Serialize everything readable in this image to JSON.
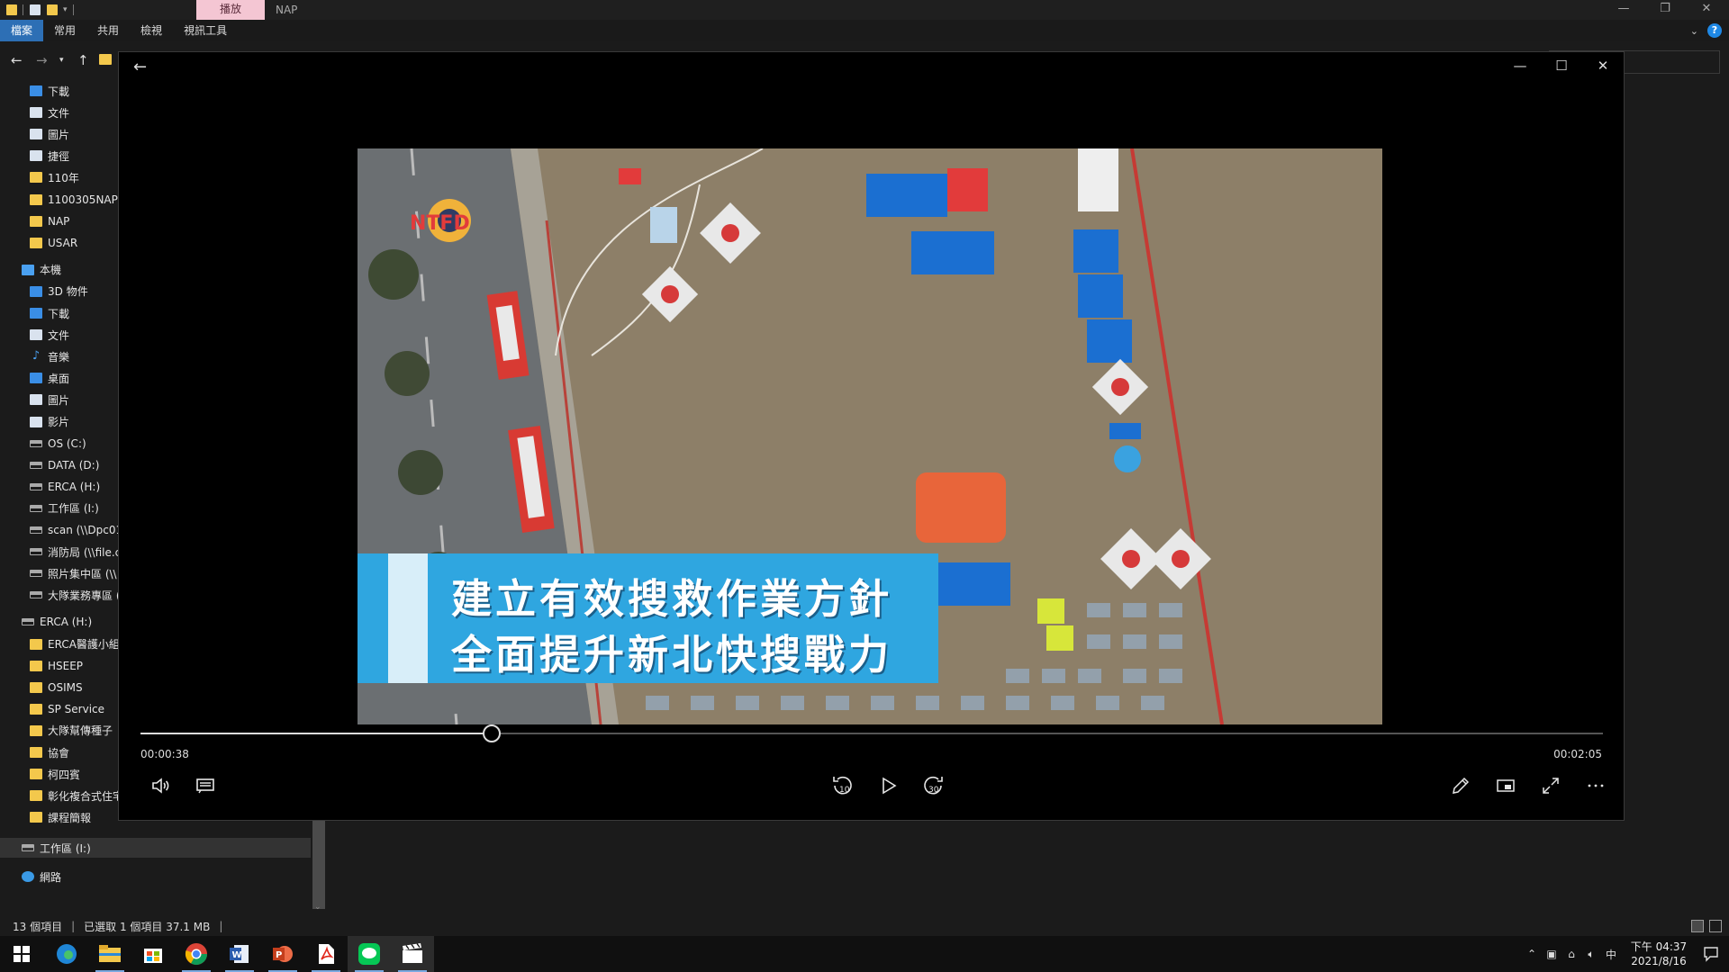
{
  "explorer": {
    "title": "NAP",
    "context_tab": "播放",
    "ribbon_tabs": [
      "檔案",
      "常用",
      "共用",
      "檢視",
      "視訊工具"
    ],
    "help_label": "?",
    "nav_items": [
      {
        "label": "下載",
        "icon": "download-icon",
        "indent": 1
      },
      {
        "label": "文件",
        "icon": "document-icon",
        "indent": 1
      },
      {
        "label": "圖片",
        "icon": "picture-icon",
        "indent": 1
      },
      {
        "label": "捷徑",
        "icon": "shortcut-icon",
        "indent": 1
      },
      {
        "label": "110年",
        "icon": "folder-icon",
        "indent": 1
      },
      {
        "label": "1100305NAP",
        "icon": "folder-icon",
        "indent": 1
      },
      {
        "label": "NAP",
        "icon": "folder-icon",
        "indent": 1
      },
      {
        "label": "USAR",
        "icon": "folder-icon",
        "indent": 1
      },
      {
        "label": "本機",
        "icon": "computer-icon",
        "indent": 0
      },
      {
        "label": "3D 物件",
        "icon": "3d-objects-icon",
        "indent": 1
      },
      {
        "label": "下載",
        "icon": "download-icon",
        "indent": 1
      },
      {
        "label": "文件",
        "icon": "document-icon",
        "indent": 1
      },
      {
        "label": "音樂",
        "icon": "music-icon",
        "indent": 1
      },
      {
        "label": "桌面",
        "icon": "desktop-icon",
        "indent": 1
      },
      {
        "label": "圖片",
        "icon": "picture-icon",
        "indent": 1
      },
      {
        "label": "影片",
        "icon": "video-icon",
        "indent": 1
      },
      {
        "label": "OS (C:)",
        "icon": "drive-icon",
        "indent": 1
      },
      {
        "label": "DATA (D:)",
        "icon": "drive-icon",
        "indent": 1
      },
      {
        "label": "ERCA (H:)",
        "icon": "drive-icon",
        "indent": 1
      },
      {
        "label": "工作區 (I:)",
        "icon": "drive-icon",
        "indent": 1
      },
      {
        "label": "scan (\\\\Dpc01",
        "icon": "network-drive-icon",
        "indent": 1
      },
      {
        "label": "消防局 (\\\\file.c",
        "icon": "network-drive-icon",
        "indent": 1
      },
      {
        "label": "照片集中區 (\\\\",
        "icon": "network-drive-icon",
        "indent": 1
      },
      {
        "label": "大隊業務專區 (",
        "icon": "network-drive-icon",
        "indent": 1
      },
      {
        "label": "ERCA (H:)",
        "icon": "drive-icon",
        "indent": 0
      },
      {
        "label": "ERCA醫護小組",
        "icon": "folder-icon",
        "indent": 1
      },
      {
        "label": "HSEEP",
        "icon": "folder-icon",
        "indent": 1
      },
      {
        "label": "OSIMS",
        "icon": "folder-icon",
        "indent": 1
      },
      {
        "label": "SP Service",
        "icon": "folder-icon",
        "indent": 1
      },
      {
        "label": "大隊幫傳種子",
        "icon": "folder-icon",
        "indent": 1
      },
      {
        "label": "協會",
        "icon": "folder-icon",
        "indent": 1
      },
      {
        "label": "柯四賓",
        "icon": "folder-icon",
        "indent": 1
      },
      {
        "label": "彰化複合式住宅",
        "icon": "folder-icon",
        "indent": 1
      },
      {
        "label": "課程簡報",
        "icon": "folder-icon",
        "indent": 1
      }
    ],
    "nav_bottom": [
      {
        "label": "工作區 (I:)",
        "icon": "drive-icon",
        "selected": true
      },
      {
        "label": "網路",
        "icon": "network-icon",
        "selected": false
      }
    ],
    "status": {
      "item_count": "13 個項目",
      "selection": "已選取 1 個項目  37.1 MB"
    }
  },
  "player": {
    "time_current": "00:00:38",
    "time_total": "00:02:05",
    "progress_fraction": 0.24,
    "skip_back_label": "10",
    "skip_forward_label": "30",
    "caption_line1": "建立有效搜救作業方針",
    "caption_line2": "全面提升新北快搜戰力",
    "logo_text": "NTFD",
    "colors": {
      "caption_bg": "#2fa6e0",
      "tent_blue": "#1b6fd1",
      "tent_red": "#e23b3b",
      "field": "#8d7f68"
    }
  },
  "taskbar": {
    "apps": [
      "windows-start-icon",
      "edge-icon",
      "file-explorer-icon",
      "store-icon",
      "chrome-icon",
      "word-icon",
      "powerpoint-icon",
      "acrobat-icon",
      "line-icon",
      "movies-tv-icon"
    ],
    "ime": "中",
    "clock_time": "下午 04:37",
    "clock_date": "2021/8/16"
  }
}
